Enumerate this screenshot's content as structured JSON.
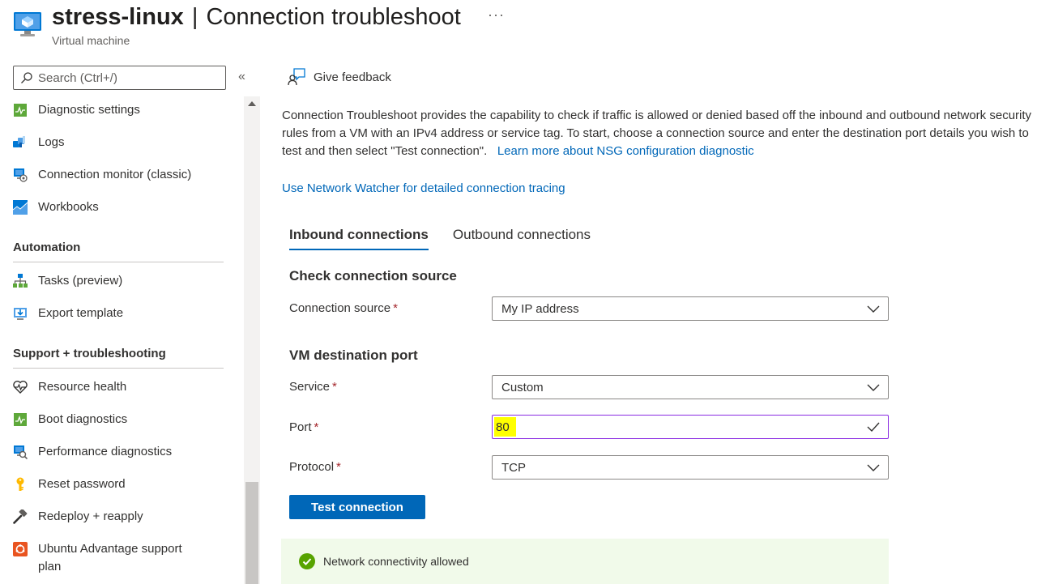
{
  "header": {
    "resource_name": "stress-linux",
    "separator": "|",
    "page_name": "Connection troubleshoot",
    "subtitle": "Virtual machine",
    "more_label": "···",
    "icon": "virtual-machine-icon"
  },
  "sidebar": {
    "search_placeholder": "Search (Ctrl+/)",
    "collapse_label": "«",
    "items_top": [
      {
        "label": "Diagnostic settings",
        "icon": "diagnostic-settings-icon"
      },
      {
        "label": "Logs",
        "icon": "logs-icon"
      },
      {
        "label": "Connection monitor (classic)",
        "icon": "connection-monitor-icon"
      },
      {
        "label": "Workbooks",
        "icon": "workbooks-icon"
      }
    ],
    "sections": [
      {
        "title": "Automation",
        "items": [
          {
            "label": "Tasks (preview)",
            "icon": "tasks-icon"
          },
          {
            "label": "Export template",
            "icon": "export-template-icon"
          }
        ]
      },
      {
        "title": "Support + troubleshooting",
        "items": [
          {
            "label": "Resource health",
            "icon": "resource-health-icon"
          },
          {
            "label": "Boot diagnostics",
            "icon": "boot-diagnostics-icon"
          },
          {
            "label": "Performance diagnostics",
            "icon": "performance-diagnostics-icon"
          },
          {
            "label": "Reset password",
            "icon": "key-icon"
          },
          {
            "label": "Redeploy + reapply",
            "icon": "hammer-icon"
          },
          {
            "label": "Ubuntu Advantage support",
            "label_line2": "plan",
            "icon": "ubuntu-icon"
          }
        ]
      }
    ]
  },
  "main": {
    "feedback_label": "Give feedback",
    "description": "Connection Troubleshoot provides the capability to check if traffic is allowed or denied based off the inbound and outbound network security rules from a VM with an IPv4 address or service tag. To start, choose a connection source and enter the destination port details you wish to test and then select \"Test connection\".",
    "learn_more_link": "Learn more about NSG configuration diagnostic",
    "network_watcher_link": "Use Network Watcher for detailed connection tracing",
    "tabs": [
      {
        "label": "Inbound connections",
        "active": true
      },
      {
        "label": "Outbound connections",
        "active": false
      }
    ],
    "source_section": {
      "title": "Check connection source",
      "connection_source_label": "Connection source",
      "connection_source_value": "My IP address"
    },
    "port_section": {
      "title": "VM destination port",
      "service_label": "Service",
      "service_value": "Custom",
      "port_label": "Port",
      "port_value": "80",
      "protocol_label": "Protocol",
      "protocol_value": "TCP"
    },
    "required_marker": "*",
    "test_button": "Test connection",
    "result": {
      "message": "Network connectivity allowed",
      "status_color": "#57a300"
    }
  },
  "colors": {
    "accent": "#0067b8",
    "highlight": "#ffff00",
    "success_bg": "#f1faea"
  }
}
